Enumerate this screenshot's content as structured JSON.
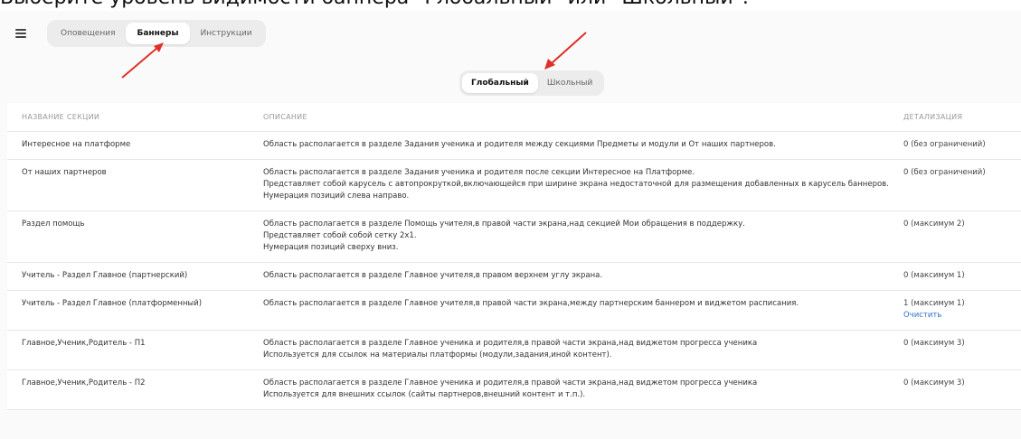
{
  "caption": "Выберите уровень видимости баннера \"Глобальный\" или \"Школьный\".",
  "nav": {
    "tabs": [
      {
        "label": "Оповещения",
        "active": false
      },
      {
        "label": "Баннеры",
        "active": true
      },
      {
        "label": "Инструкции",
        "active": false
      }
    ]
  },
  "levels": {
    "options": [
      {
        "label": "Глобальный",
        "active": true
      },
      {
        "label": "Школьный",
        "active": false
      }
    ]
  },
  "table": {
    "headers": {
      "name": "НАЗВАНИЕ СЕКЦИИ",
      "description": "ОПИСАНИЕ",
      "detail": "ДЕТАЛИЗАЦИЯ"
    },
    "rows": [
      {
        "name": "Интересное на платформе",
        "desc": [
          "Область располагается в разделе Задания ученика и родителя между секциями Предметы и модули и От наших партнеров."
        ],
        "detail": "0 (без ограничений)",
        "action": ""
      },
      {
        "name": "От наших партнеров",
        "desc": [
          "Область располагается в разделе Задания ученика и родителя после секции Интересное на Платформе.",
          "Представляет собой карусель с автопрокруткой,включающейся при ширине экрана недостаточной для размещения добавленных в карусель баннеров.",
          "Нумерация позиций слева направо."
        ],
        "detail": "0 (без ограничений)",
        "action": ""
      },
      {
        "name": "Раздел помощь",
        "desc": [
          "Область располагается в разделе Помощь учителя,в правой части экрана,над секцией Мои обращения в поддержку.",
          "Представляет собой собой сетку 2x1.",
          "Нумерация позиций сверху вниз."
        ],
        "detail": "0 (максимум 2)",
        "action": ""
      },
      {
        "name": "Учитель - Раздел Главное (партнерский)",
        "desc": [
          "Область располагается в разделе Главное учителя,в правом верхнем углу экрана."
        ],
        "detail": "0 (максимум 1)",
        "action": ""
      },
      {
        "name": "Учитель - Раздел Главное (платформенный)",
        "desc": [
          "Область располагается в разделе Главное учителя,в правой части экрана,между партнерским баннером и виджетом расписания."
        ],
        "detail": "1 (максимум 1)",
        "action": "Очистить"
      },
      {
        "name": "Главное,Ученик,Родитель - П1",
        "desc": [
          "Область располагается в разделе Главное ученика и родителя,в правой части экрана,над виджетом прогресса ученика",
          "Используется для ссылок на материалы платформы (модули,задания,иной контент)."
        ],
        "detail": "0 (максимум 3)",
        "action": ""
      },
      {
        "name": "Главное,Ученик,Родитель - П2",
        "desc": [
          "Область располагается в разделе Главное ученика и родителя,в правой части экрана,над виджетом прогресса ученика",
          "Используется для внешних ссылок (сайты партнеров,внешний контент и т.п.)."
        ],
        "detail": "0 (максимум 3)",
        "action": ""
      }
    ]
  },
  "colors": {
    "arrow": "#e0302a",
    "link": "#2b73c7"
  },
  "icons": {
    "menu": "hamburger-menu-icon"
  }
}
